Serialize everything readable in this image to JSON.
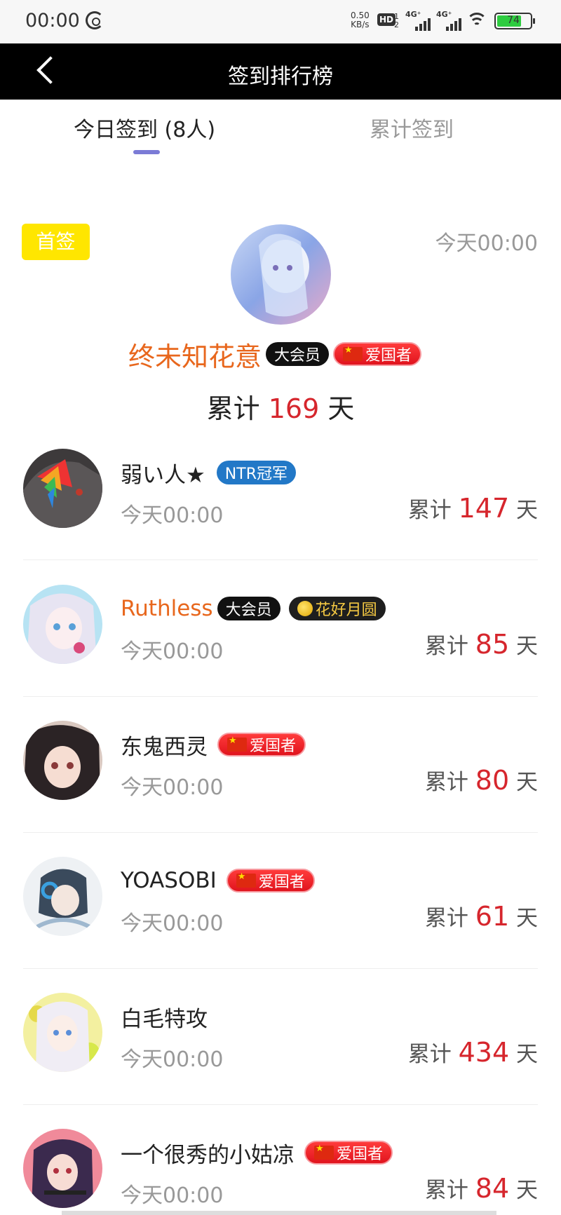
{
  "status_bar": {
    "time": "00:00",
    "speed_value": "0.50",
    "speed_unit": "KB/s",
    "hd": "HD",
    "hd_sub_1": "1",
    "hd_sub_2": "2",
    "signal_1": "4G⁺",
    "signal_2": "4G⁺",
    "battery_percent": "74",
    "battery_level": 0.74
  },
  "header": {
    "title": "签到排行榜",
    "back_icon": "chevron-left-icon"
  },
  "tabs": [
    {
      "label": "今日签到 (8人)",
      "active": true
    },
    {
      "label": "累计签到",
      "active": false
    }
  ],
  "top_entry": {
    "badge": "首签",
    "time": "今天00:00",
    "name": "终未知花意",
    "badges": [
      {
        "type": "vip",
        "label": "大会员"
      },
      {
        "type": "patriot",
        "label": "爱国者"
      }
    ],
    "total_prefix": "累计",
    "total_days": "169",
    "total_suffix": "天"
  },
  "entries": [
    {
      "name": "弱い人★",
      "name_color": "default",
      "badges": [
        {
          "type": "ntr",
          "label": "NTR冠军"
        }
      ],
      "time": "今天00:00",
      "total_prefix": "累计",
      "total_days": "147",
      "total_suffix": "天"
    },
    {
      "name": "Ruthless",
      "name_color": "orange",
      "badges": [
        {
          "type": "vip",
          "label": "大会员"
        },
        {
          "type": "moon",
          "label": "花好月圆"
        }
      ],
      "time": "今天00:00",
      "total_prefix": "累计",
      "total_days": "85",
      "total_suffix": "天"
    },
    {
      "name": "东鬼西灵",
      "name_color": "default",
      "badges": [
        {
          "type": "patriot",
          "label": "爱国者"
        }
      ],
      "time": "今天00:00",
      "total_prefix": "累计",
      "total_days": "80",
      "total_suffix": "天"
    },
    {
      "name": "YOASOBI",
      "name_color": "default",
      "badges": [
        {
          "type": "patriot",
          "label": "爱国者"
        }
      ],
      "time": "今天00:00",
      "total_prefix": "累计",
      "total_days": "61",
      "total_suffix": "天"
    },
    {
      "name": "白毛特攻",
      "name_color": "default",
      "badges": [],
      "time": "今天00:00",
      "total_prefix": "累计",
      "total_days": "434",
      "total_suffix": "天"
    },
    {
      "name": "一个很秀的小姑凉",
      "name_color": "default",
      "badges": [
        {
          "type": "patriot",
          "label": "爱国者"
        }
      ],
      "time": "今天00:00",
      "total_prefix": "累计",
      "total_days": "84",
      "total_suffix": "天"
    }
  ],
  "colors": {
    "accent_orange": "#e8671d",
    "days_red": "#d6262d",
    "tab_underline": "#7b7bd6",
    "first_badge_yellow": "#ffe600"
  }
}
